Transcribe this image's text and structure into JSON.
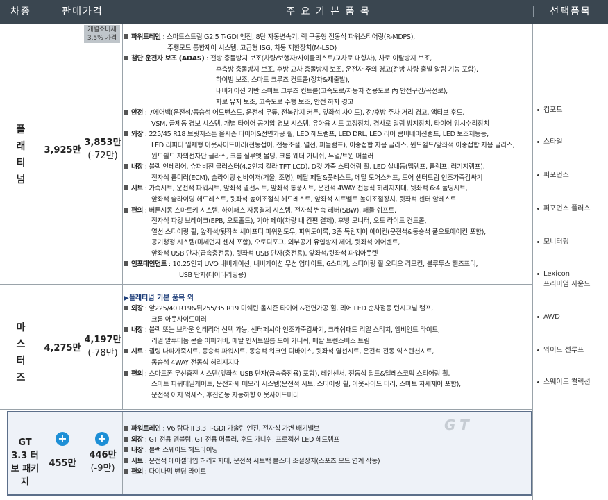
{
  "header": {
    "col_trim": "차종",
    "col_price": "판매가격",
    "col_features": "주 요 기 본 품 목",
    "col_options": "선택품목"
  },
  "tax_badge": "개별소비세 3.5% 가격",
  "rows": {
    "platinum": {
      "name": "플래티넘",
      "price": "3,925만",
      "tax_price": "3,853만",
      "tax_diff": "(-72만)"
    },
    "masters": {
      "name": "마스터즈",
      "price": "4,275만",
      "tax_price": "4,197만",
      "tax_diff": "(-78만)"
    },
    "gt": {
      "name": "GT 3.3 터보 패키지",
      "price": "455만",
      "tax_price": "446만",
      "tax_diff": "(-9만)"
    }
  },
  "platinum_features": [
    {
      "head": "파워트레인",
      "lines": [
        "스마트스트림 G2.5 T-GDI 엔진, 8단 자동변속기, 랙 구동형 전동식 파워스티어링(R-MDPS),",
        "주행모드 통합제어 시스템, 고급형 ISG, 차동 제한장치(M-LSD)"
      ]
    },
    {
      "head": "첨단 운전자 보조 (ADAS)",
      "lines": [
        "전방 충돌방지 보조(차량/보행자/사이클리스트/교차로 대향차), 차로 이탈방지 보조,",
        "후측방 충돌방지 보조, 후방 교차 충돌방지 보조, 운전자 주의 경고(전방 차량 출발 알림 기능 포함),",
        "하이빔 보조, 스마트 크루즈 컨트롤(정차&재출발),",
        "내비게이션 기반 스마트 크루즈 컨트롤(고속도로/자동차 전용도로 內 안전구간/곡선로),",
        "차로 유지 보조, 고속도로 주행 보조, 안전 하차 경고"
      ]
    },
    {
      "head": "안전",
      "lines": [
        "7에어백(운전석/동승석 어드밴스드, 운전석 무릎, 전복감지 커튼, 앞좌석 사이드), 전/후방 주차 거리 경고, 액티브 후드,",
        "VSM, 급제동 경보 시스템, 개별 타이어 공기압 경보 시스템, 유아용 시트 고정장치, 경사로 밀림 방지장치, 타이어 임시수리장치"
      ]
    },
    {
      "head": "외장",
      "lines": [
        "225/45 R18 브릿지스톤 올시즌 타이어&전면가공 휠, LED 헤드램프, LED DRL, LED 리어 콤비네이션램프, LED 보조제동등,",
        "LED 리피터 일체형 아웃사이드미러(전동접이, 전동조절, 열선, 퍼들램프), 이중접합 차음 글라스, 윈드쉴드/앞좌석 이중접합 차음 글라스,",
        "윈드쉴드 자외선차단 글라스, 크롬 실루엣 몰딩, 크롬 웨더 가니쉬, 듀얼/트윈 머플러"
      ]
    },
    {
      "head": "내장",
      "lines": [
        "블랙 인테리어, 슈퍼비전 클러스터(4.2인치 칼라 TFT LCD), D컷 가죽 스티어링 휠, LED 실내등(맵램프, 룸램프, 러기지램프),",
        "전자식 룸미러(ECM), 슬라이딩 선바이저(거울, 조명), 메탈 페달&풋레스트, 메탈 도어스커프, 도어 센터트림 인조가죽감싸기"
      ]
    },
    {
      "head": "시트",
      "lines": [
        "가죽시트, 운전석 파워시트, 앞좌석 열선시트, 앞좌석 통풍시트, 운전석 4WAY 전동식 허리지지대, 뒷좌석 6:4 폴딩시트,",
        "앞좌석 슬라이딩 헤드레스트, 뒷좌석 높이조절식 헤드레스트, 앞좌석 시트벨트 높이조절장치, 뒷좌석 센터 암레스트"
      ]
    },
    {
      "head": "편의",
      "lines": [
        "버튼시동 스마트키 시스템, 하이패스 자동결제 시스템, 전자식 변속 레버(SBW), 패들 쉬프트,",
        "전자식 파킹 브레이크(EPB, 오토홀드), 기아 페이(차량 내 간편 결제), 후방 모니터, 오토 라이트 컨트롤,",
        "열선 스티어링 휠, 앞좌석/뒷좌석 세이프티 파워윈도우, 파워도어록, 3존 독립제어 에어컨(운전석&동승석 풀오토에어컨 포함),",
        "공기청정 시스템(미세먼지 센서 포함), 오토디포그, 외부공기 유입방지 제어, 뒷좌석 에어벤트,",
        "앞좌석 USB 단자(급속충전용), 뒷좌석 USB 단자(충전용), 앞좌석/뒷좌석 파워아웃렛"
      ]
    },
    {
      "head": "인포테인먼트",
      "lines": [
        "10.25인치 UVO 내비게이션, 내비게이션 무선 업데이트, 6스피커, 스티어링 휠 오디오 리모컨, 블루투스 핸즈프리,",
        "USB 단자(데이터리딩용)"
      ]
    }
  ],
  "masters_subhead": "▶플래티넘 기본 품목 외",
  "masters_features": [
    {
      "head": "외장",
      "lines": [
        "앞225/40 R19&뒤255/35 R19 미쉐린 올시즌 타이어 &전면가공 휠, 리어 LED 순차점등 턴시그널 램프,",
        "크롬 아웃사이드미러"
      ]
    },
    {
      "head": "내장",
      "lines": [
        "블랙 또는 브라운 인테리어 선택 가능, 센터페시아 인조가죽감싸기, 크래쉬패드 리얼 스티치, 앰비언트 라이트,",
        "리얼 알루미늄 콘솔 어퍼커버, 메탈 인서트필름 도어 가니쉬, 메탈 트렌스버스 트림"
      ]
    },
    {
      "head": "시트",
      "lines": [
        "퀼팅 나파가죽시트, 동승석 파워시트, 동승석 워크인 디바이스, 뒷좌석 열선시트, 운전석 전동 익스텐션시트,",
        "동승석 4WAY 전동식 허리지지대"
      ]
    },
    {
      "head": "편의",
      "lines": [
        "스마트폰 무선충전 시스템(앞좌석 USB 단자(급속충전용) 포함), 레인센서, 전동식 틸트&텔레스코픽 스티어링 휠,",
        "스마트 파워테일게이트, 운전자세 메모리 시스템(운전석 시트, 스티어링 휠, 아웃사이드 미러, 스마트 자세제어 포함),",
        "운전석 이지 억세스, 후진연동 자동하향 아웃사이드미러"
      ]
    }
  ],
  "gt_features": [
    {
      "head": "파워트레인",
      "lines": [
        "V6 람다 II 3.3 T-GDI 가솔린 엔진, 전자식 가변 배기밸브"
      ]
    },
    {
      "head": "외장",
      "lines": [
        "GT 전용 엠블럼, GT 전용 머플러, 후드 가니쉬, 프로젝션 LED 헤드램프"
      ]
    },
    {
      "head": "내장",
      "lines": [
        "블랙 스웨이드 헤드라이닝"
      ]
    },
    {
      "head": "시트",
      "lines": [
        "운전석 에어셀타입 허리지지대, 운전석 시트백 볼스터 조절장치(스포츠 모드 연계 작동)"
      ]
    },
    {
      "head": "편의",
      "lines": [
        "다이나믹 밴딩 라이트"
      ]
    }
  ],
  "gt_logo": "GT",
  "options": [
    "컴포트",
    "스타일",
    "퍼포먼스",
    "퍼포먼스 플러스",
    "모니터링",
    "Lexicon 프리미엄 사운드",
    "AWD",
    "와이드 선루프",
    "스웨이드 컬렉션"
  ],
  "colors": {
    "header_bg": "#3a4650",
    "plus_blue": "#1d8fd6",
    "gt_border": "#5c6f8a"
  }
}
